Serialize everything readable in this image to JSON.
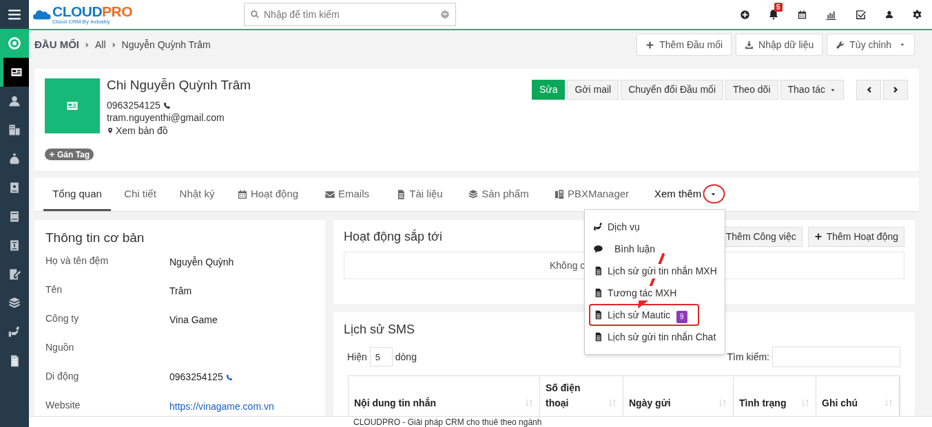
{
  "header": {
    "logo_main": "CLOUD",
    "logo_accent": "PRO",
    "logo_tagline": "Cloud CRM By Industry",
    "search_placeholder": "Nhập để tìm kiếm",
    "notification_count": "5"
  },
  "sidebar": {
    "items": [
      {
        "kind": "target",
        "selected": false
      },
      {
        "kind": "card",
        "selected": true
      },
      {
        "kind": "user",
        "selected": false
      },
      {
        "kind": "building",
        "selected": false
      },
      {
        "kind": "money",
        "selected": false
      },
      {
        "kind": "contact",
        "selected": false
      },
      {
        "kind": "so",
        "selected": false
      },
      {
        "kind": "doc",
        "selected": false
      },
      {
        "kind": "edit",
        "selected": false
      },
      {
        "kind": "box",
        "selected": false
      },
      {
        "kind": "service",
        "selected": false
      },
      {
        "kind": "file",
        "selected": false
      }
    ]
  },
  "breadcrumb": [
    "ĐẦU MỐI",
    "All",
    "Nguyễn Quỳnh Trâm"
  ],
  "page_actions": [
    {
      "kind": "add",
      "label": "Thêm Đầu mối"
    },
    {
      "kind": "import",
      "label": "Nhập dữ liệu"
    },
    {
      "kind": "customize",
      "label": "Tùy chỉnh"
    }
  ],
  "record": {
    "name": "Chi Nguyễn Quỳnh Trâm",
    "phone": "0963254125",
    "email": "tram.nguyenthi@gmail.com",
    "map_link": "Xem bản đồ",
    "tag_button": "Gán Tag"
  },
  "record_actions": [
    {
      "label": "Sửa",
      "kind": "primary"
    },
    {
      "label": "Gởi mail",
      "kind": "plain"
    },
    {
      "label": "Chuyển đổi Đầu mối",
      "kind": "plain"
    },
    {
      "label": "Theo dõi",
      "kind": "plain"
    },
    {
      "label": "Thao tác",
      "kind": "dropdown"
    }
  ],
  "tabs": [
    {
      "label": "Tổng quan",
      "kind": "plain",
      "selected": true
    },
    {
      "label": "Chi tiết",
      "kind": "plain",
      "selected": false
    },
    {
      "label": "Nhật ký",
      "kind": "plain",
      "selected": false
    },
    {
      "label": "Hoạt động",
      "kind": "calendar",
      "selected": false
    },
    {
      "label": "Emails",
      "kind": "mail",
      "selected": false
    },
    {
      "label": "Tài liệu",
      "kind": "file",
      "selected": false
    },
    {
      "label": "Sản phẩm",
      "kind": "box",
      "selected": false
    },
    {
      "label": "PBXManager",
      "kind": "phone",
      "selected": false
    },
    {
      "label": "Xem thêm",
      "kind": "more",
      "selected": false,
      "expanded": true
    }
  ],
  "more_menu": [
    {
      "label": "Dịch vụ",
      "kind": "service",
      "highlighted": false
    },
    {
      "label": "Bình luận",
      "kind": "comment",
      "highlighted": false
    },
    {
      "label": "Lịch sử gửi tin nhắn MXH",
      "kind": "file",
      "highlighted": false
    },
    {
      "label": "Tương tác MXH",
      "kind": "file",
      "highlighted": false
    },
    {
      "label": "Lịch sử Mautic",
      "kind": "file",
      "highlighted": true,
      "badge": "9"
    },
    {
      "label": "Lịch sử gửi tin nhắn Chat",
      "kind": "file",
      "highlighted": false
    }
  ],
  "basic_info": {
    "title": "Thông tin cơ bản",
    "fields": [
      {
        "label": "Họ và tên đệm",
        "value": "Nguyễn Quỳnh",
        "kind": "text"
      },
      {
        "label": "Tên",
        "value": "Trâm",
        "kind": "text"
      },
      {
        "label": "Công ty",
        "value": "Vina Game",
        "kind": "text"
      },
      {
        "label": "Nguồn"
      },
      {
        "label": "Di động",
        "value": "0963254125",
        "kind": "phone"
      },
      {
        "label": "Website",
        "value": "https://vinagame.com.vn",
        "kind": "link"
      }
    ]
  },
  "upcoming": {
    "title": "Hoạt động sắp tới",
    "buttons": [
      "Thêm Công việc",
      "Thêm Hoạt động"
    ],
    "empty_text": "Không c"
  },
  "sms": {
    "title": "Lịch sử SMS",
    "show_label": "Hiện",
    "page_size": "5",
    "rows_label": "dòng",
    "search_label": "Tìm kiếm:",
    "columns": [
      "Nội dung tin nhắn",
      "Số điện thoại",
      "Ngày gửi",
      "Tình trạng",
      "Ghi chú"
    ]
  },
  "footer": "CLOUDPRO - Giải pháp CRM cho thuê theo ngành"
}
